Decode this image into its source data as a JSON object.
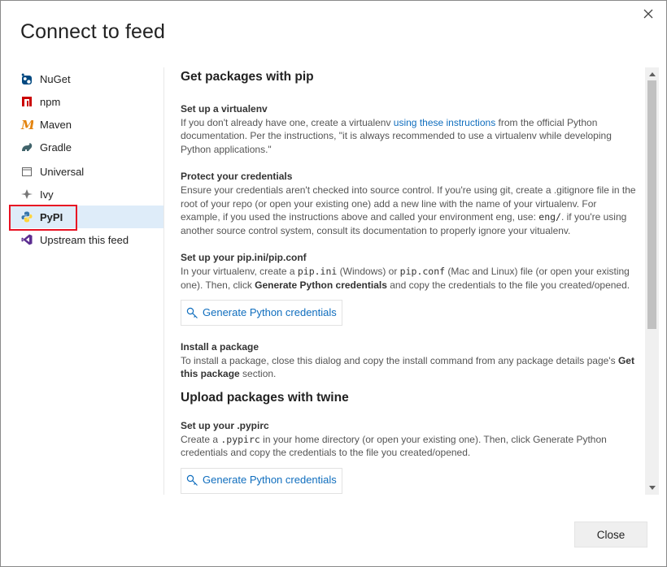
{
  "dialog": {
    "title": "Connect to feed",
    "close_label": "Close"
  },
  "sidebar": {
    "items": [
      {
        "label": "NuGet",
        "icon": "nuget-icon"
      },
      {
        "label": "npm",
        "icon": "npm-icon"
      },
      {
        "label": "Maven",
        "icon": "maven-icon"
      },
      {
        "label": "Gradle",
        "icon": "gradle-icon"
      },
      {
        "label": "Universal",
        "icon": "universal-icon"
      },
      {
        "label": "Ivy",
        "icon": "ivy-icon"
      },
      {
        "label": "PyPI",
        "icon": "python-icon",
        "selected": true
      },
      {
        "label": "Upstream this feed",
        "icon": "visual-studio-icon"
      }
    ]
  },
  "content": {
    "heading_get": "Get packages with pip",
    "venv": {
      "title": "Set up a virtualenv",
      "text1": "If you don't already have one, create a virtualenv ",
      "link": "using these instructions",
      "text2": " from the official Python documentation. Per the instructions, \"it is always recommended to use a virtualenv while developing Python applications.\""
    },
    "creds": {
      "title": "Protect your credentials",
      "text1": "Ensure your credentials aren't checked into source control. If you're using git, create a .gitignore file in the root of your repo (or open your existing one) add a new line with the name of your virtualenv. For example, if you used the instructions above and called your environment eng, use: ",
      "code": "eng/",
      "text2": ". if you're using another source control system, consult its documentation to properly ignore your vitualenv."
    },
    "pipconf": {
      "title": "Set up your pip.ini/pip.conf",
      "text1": "In your virtualenv, create a ",
      "code1": "pip.ini",
      "text2": " (Windows) or ",
      "code2": "pip.conf",
      "text3": " (Mac and Linux) file (or open your existing one). Then, click ",
      "bold": "Generate Python credentials",
      "text4": " and copy the credentials to the file you created/opened."
    },
    "generate_button": "Generate Python credentials",
    "install": {
      "title": "Install a package",
      "text1": "To install a package, close this dialog and copy the install command from any package details page's ",
      "bold": "Get this package",
      "text2": " section."
    },
    "heading_upload": "Upload packages with twine",
    "pypirc": {
      "title": "Set up your .pypirc",
      "text1": "Create a ",
      "code": ".pypirc",
      "text2": " in your home directory (or open your existing one). Then, click Generate Python credentials and copy the credentials to the file you created/opened."
    },
    "generate_button_2": "Generate Python credentials"
  },
  "colors": {
    "accent": "#106ebe",
    "selected_bg": "#deecf9",
    "highlight_border": "#e81123"
  }
}
